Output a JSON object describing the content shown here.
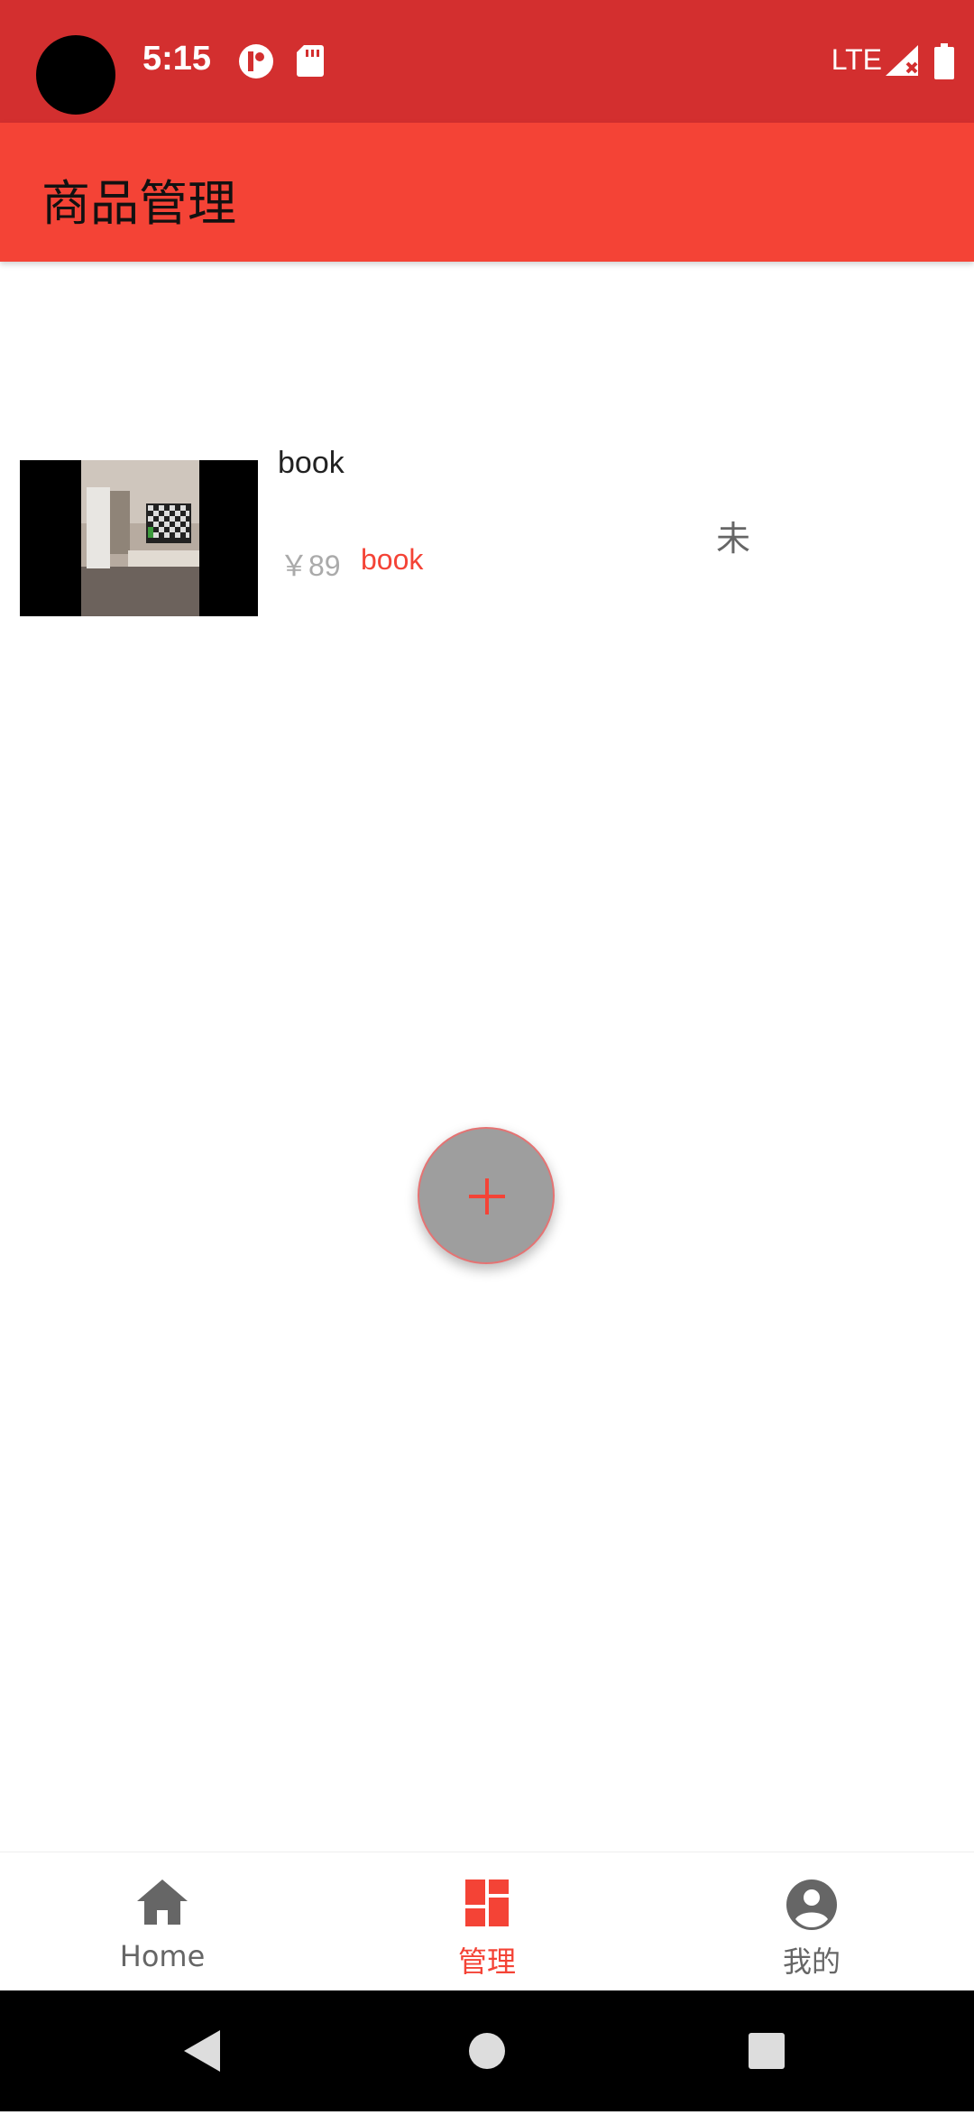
{
  "status_bar": {
    "time": "5:15",
    "network": "LTE"
  },
  "app_bar": {
    "title": "商品管理"
  },
  "products": [
    {
      "name": "book",
      "price": "￥89",
      "category": "book",
      "status": "未"
    }
  ],
  "fab": {
    "icon": "add-icon"
  },
  "bottom_nav": {
    "items": [
      {
        "label": "Home",
        "icon": "home-icon"
      },
      {
        "label": "管理",
        "icon": "dashboard-icon",
        "active": true
      },
      {
        "label": "我的",
        "icon": "account-circle-icon"
      }
    ]
  },
  "colors": {
    "status_bar": "#d32f2f",
    "app_bar": "#f44336",
    "accent": "#f44336",
    "fab": "#9e9e9e"
  }
}
